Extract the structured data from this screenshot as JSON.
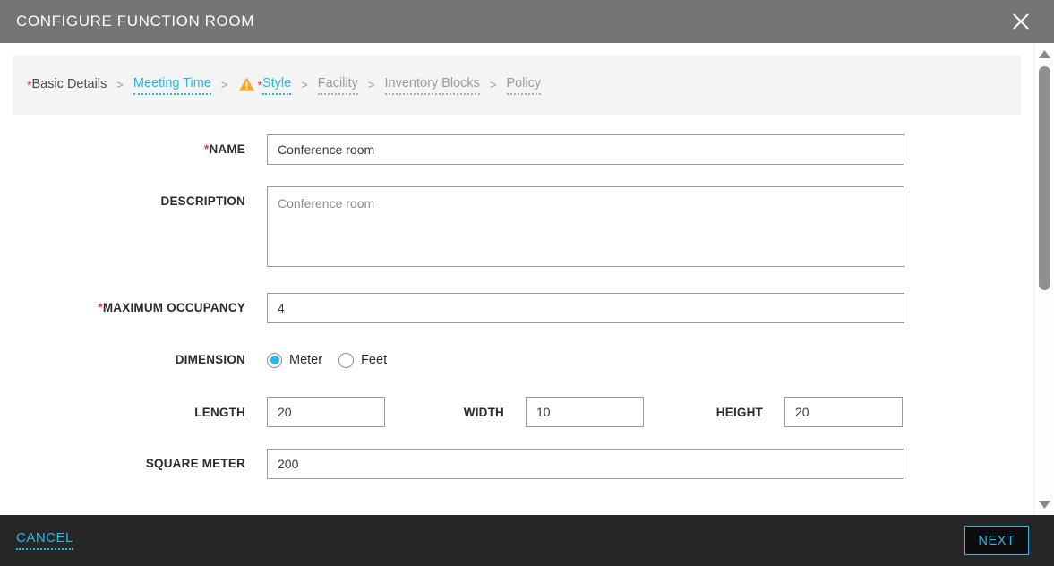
{
  "header": {
    "title": "CONFIGURE FUNCTION ROOM",
    "close_label": "close-icon",
    "bg": "#757575"
  },
  "colors": {
    "accent_cyan": "#29b6e8",
    "required_red": "#e8392f",
    "warning_amber": "#f5a623",
    "header_gray": "#757575",
    "footer_dark": "#262626",
    "breadcrumb_bg": "#f4f4f4"
  },
  "breadcrumb": {
    "separator": ">",
    "items": [
      {
        "label": "Basic Details",
        "required": true,
        "state": "done",
        "underline": false,
        "warning": false
      },
      {
        "label": "Meeting Time",
        "required": false,
        "state": "active",
        "underline": true,
        "warning": false
      },
      {
        "label": "Style",
        "required": true,
        "state": "active",
        "underline": true,
        "warning": true
      },
      {
        "label": "Facility",
        "required": false,
        "state": "future",
        "underline": true,
        "warning": false
      },
      {
        "label": "Inventory Blocks",
        "required": false,
        "state": "future",
        "underline": true,
        "warning": false
      },
      {
        "label": "Policy",
        "required": false,
        "state": "future",
        "underline": true,
        "warning": false
      }
    ]
  },
  "form": {
    "name": {
      "label": "NAME",
      "required": true,
      "value": "Conference room",
      "placeholder": "Conference room"
    },
    "description": {
      "label": "DESCRIPTION",
      "required": false,
      "value": "Conference room",
      "placeholder": "Conference room"
    },
    "maximum_occupancy": {
      "label": "MAXIMUM OCCUPANCY",
      "required": true,
      "value": "4",
      "placeholder": ""
    },
    "dimension": {
      "label": "DIMENSION",
      "options": [
        {
          "label": "Meter",
          "selected": true
        },
        {
          "label": "Feet",
          "selected": false
        }
      ]
    },
    "length": {
      "label": "LENGTH",
      "value": "20",
      "placeholder": ""
    },
    "width": {
      "label": "WIDTH",
      "value": "10",
      "placeholder": ""
    },
    "height": {
      "label": "HEIGHT",
      "value": "20",
      "placeholder": ""
    },
    "square_meter": {
      "label": "SQUARE METER",
      "value": "200",
      "placeholder": ""
    }
  },
  "scrollbar": {
    "up_arrow": "chevron-up-icon",
    "down_arrow": "chevron-down-icon"
  },
  "footer": {
    "cancel_label": "CANCEL",
    "next_label": "NEXT"
  }
}
